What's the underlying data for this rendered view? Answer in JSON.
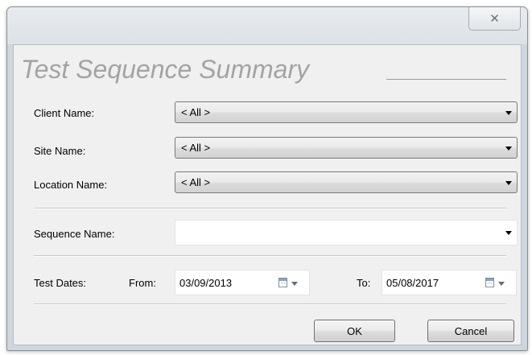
{
  "window": {
    "close_glyph": "✕"
  },
  "dialog": {
    "title": "Test Sequence Summary"
  },
  "fields": {
    "client": {
      "label": "Client Name:",
      "value": "< All >"
    },
    "site": {
      "label": "Site Name:",
      "value": "< All >"
    },
    "location": {
      "label": "Location Name:",
      "value": "< All >"
    },
    "sequence": {
      "label": "Sequence Name:",
      "value": ""
    }
  },
  "dates": {
    "label": "Test Dates:",
    "from_label": "From:",
    "from_value": "03/09/2013",
    "to_label": "To:",
    "to_value": "05/08/2017"
  },
  "buttons": {
    "ok": "OK",
    "cancel": "Cancel"
  },
  "icons": {
    "dropdown": "chevron-down-icon",
    "calendar": "calendar-icon",
    "close": "close-icon"
  }
}
